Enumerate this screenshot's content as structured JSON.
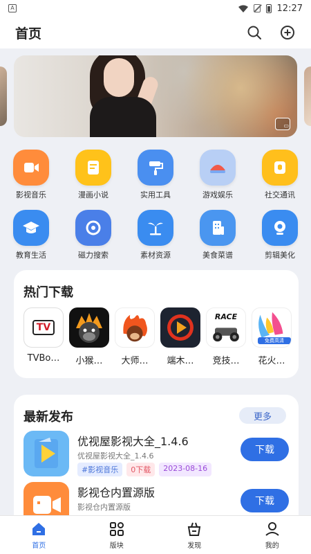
{
  "status_bar": {
    "time": "12:27",
    "left_icon": "A"
  },
  "header": {
    "title": "首页",
    "search_icon": "search-icon",
    "add_icon": "add-circle-icon"
  },
  "banner": {
    "badge_icon": "fullscreen-icon"
  },
  "categories": [
    {
      "label": "影视音乐",
      "icon": "video-camera-icon",
      "color": "#ff8c3b"
    },
    {
      "label": "漫画小说",
      "icon": "book-icon",
      "color": "#ffc21a"
    },
    {
      "label": "实用工具",
      "icon": "paint-roller-icon",
      "color": "#4a8ff0"
    },
    {
      "label": "游戏娱乐",
      "icon": "game-face-icon",
      "color": "#7aa8f2"
    },
    {
      "label": "社交通讯",
      "icon": "chat-icon",
      "color": "#ffbf1c"
    },
    {
      "label": "教育生活",
      "icon": "graduation-cap-icon",
      "color": "#3a8cf0"
    },
    {
      "label": "磁力搜索",
      "icon": "magnet-search-icon",
      "color": "#4a7fe8"
    },
    {
      "label": "素材资源",
      "icon": "palm-tree-icon",
      "color": "#3a8cf0"
    },
    {
      "label": "美食菜谱",
      "icon": "building-icon",
      "color": "#4a96f0"
    },
    {
      "label": "剪辑美化",
      "icon": "webcam-icon",
      "color": "#3a8cf0"
    }
  ],
  "hot_downloads": {
    "title": "热门下载",
    "items": [
      {
        "name": "TVBo…",
        "thumb_text": "TV"
      },
      {
        "name": "小猴…",
        "thumb_text": ""
      },
      {
        "name": "大师…",
        "thumb_text": ""
      },
      {
        "name": "端木…",
        "thumb_text": ""
      },
      {
        "name": "竞技…",
        "thumb_text": "RACE"
      },
      {
        "name": "花火…",
        "thumb_text": "免费高清"
      }
    ]
  },
  "latest": {
    "title": "最新发布",
    "more_label": "更多",
    "apps": [
      {
        "name": "优视屋影视大全_1.4.6",
        "sub": "优视屋影视大全_1.4.6",
        "tags": [
          "#影视音乐",
          "0下载",
          "2023-08-16"
        ],
        "button": "下载"
      },
      {
        "name": "影视仓内置源版",
        "sub": "影视仓内置源版",
        "tags": [],
        "button": "下载"
      }
    ]
  },
  "bottom_nav": [
    {
      "label": "首页",
      "icon": "home-icon",
      "active": true
    },
    {
      "label": "版块",
      "icon": "grid-icon",
      "active": false
    },
    {
      "label": "发现",
      "icon": "discover-bag-icon",
      "active": false
    },
    {
      "label": "我的",
      "icon": "profile-icon",
      "active": false
    }
  ]
}
